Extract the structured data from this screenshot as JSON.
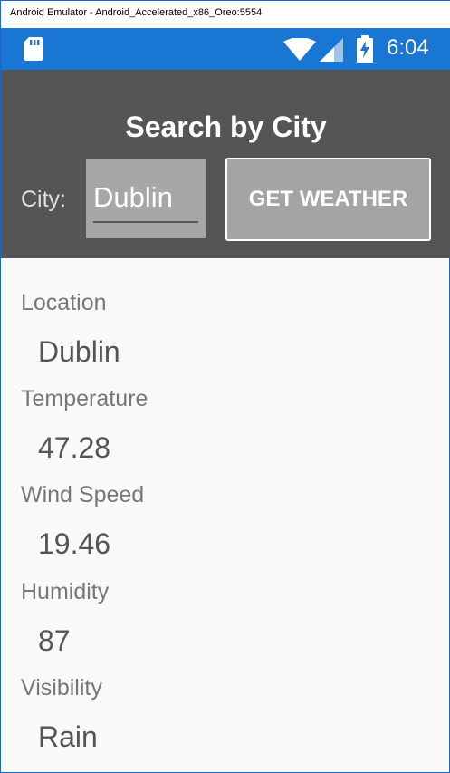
{
  "window": {
    "title": "Android Emulator - Android_Accelerated_x86_Oreo:5554"
  },
  "status_bar": {
    "time": "6:04",
    "icons": [
      "sd-card-icon",
      "wifi-icon",
      "signal-icon",
      "battery-charging-icon"
    ],
    "color": "#1976d2"
  },
  "header": {
    "title": "Search by City",
    "city_label": "City:",
    "city_value": "Dublin",
    "button_label": "GET WEATHER",
    "background": "#555555"
  },
  "results": [
    {
      "label": "Location",
      "value": "Dublin"
    },
    {
      "label": "Temperature",
      "value": "47.28"
    },
    {
      "label": "Wind Speed",
      "value": "19.46"
    },
    {
      "label": "Humidity",
      "value": "87"
    },
    {
      "label": "Visibility",
      "value": "Rain"
    }
  ]
}
